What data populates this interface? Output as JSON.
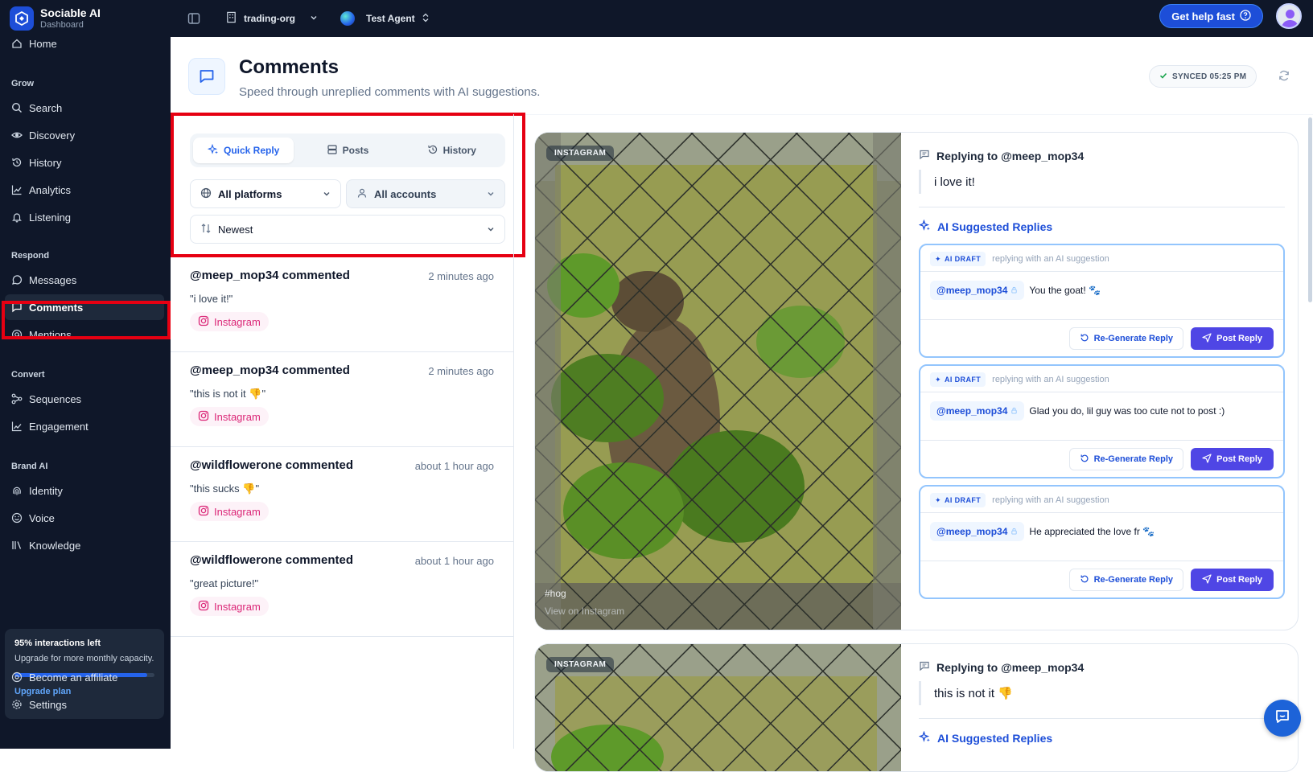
{
  "brand": {
    "name": "Sociable AI",
    "subtitle": "Dashboard"
  },
  "topbar": {
    "org": "trading-org",
    "agent": "Test Agent",
    "help_label": "Get help fast"
  },
  "sidebar": {
    "cut_item": "Home",
    "sections": {
      "grow": "Grow",
      "respond": "Respond",
      "convert": "Convert",
      "brand": "Brand AI"
    },
    "grow_items": [
      "Search",
      "Discovery",
      "History",
      "Analytics",
      "Listening"
    ],
    "respond_items": [
      "Messages",
      "Comments",
      "Mentions"
    ],
    "convert_items": [
      "Sequences",
      "Engagement"
    ],
    "brand_items": [
      "Identity",
      "Voice",
      "Knowledge"
    ],
    "active_item": "Comments",
    "upgrade": {
      "title": "95% interactions left",
      "text": "Upgrade for more monthly capacity.",
      "percent_left": 95,
      "link": "Upgrade plan"
    },
    "footer_items": [
      "Become an affiliate",
      "Settings"
    ]
  },
  "header": {
    "title": "Comments",
    "subtitle": "Speed through unreplied comments with AI suggestions.",
    "synced": "SYNCED 05:25 PM"
  },
  "filters": {
    "tabs": [
      "Quick Reply",
      "Posts",
      "History"
    ],
    "active_tab": "Quick Reply",
    "platform": "All platforms",
    "accounts": "All accounts",
    "sort": "Newest"
  },
  "comments": [
    {
      "user": "@meep_mop34 commented",
      "time": "2 minutes ago",
      "text": "\"i love it!\"",
      "platform": "Instagram"
    },
    {
      "user": "@meep_mop34 commented",
      "time": "2 minutes ago",
      "text": "\"this is not it 👎\"",
      "platform": "Instagram"
    },
    {
      "user": "@wildflowerone commented",
      "time": "about 1 hour ago",
      "text": "\"this sucks 👎\"",
      "platform": "Instagram"
    },
    {
      "user": "@wildflowerone commented",
      "time": "about 1 hour ago",
      "text": "\"great picture!\"",
      "platform": "Instagram"
    }
  ],
  "detail": {
    "media_badge": "INSTAGRAM",
    "media_caption": "#hog",
    "media_link": "View on Instagram",
    "replying_to": "Replying to @meep_mop34",
    "quote": "i love it!",
    "suggested_title": "AI Suggested Replies",
    "draft_tag": "AI DRAFT",
    "draft_hint": "replying with an AI suggestion",
    "mention": "@meep_mop34",
    "drafts": [
      {
        "text": "You the goat! 🐾"
      },
      {
        "text": "Glad you do, lil guy was too cute not to post :)"
      },
      {
        "text": "He appreciated the love fr 🐾"
      }
    ],
    "regen_label": "Re-Generate Reply",
    "post_label": "Post Reply"
  },
  "detail2": {
    "media_badge": "INSTAGRAM",
    "replying_to": "Replying to @meep_mop34",
    "quote": "this is not it 👎",
    "suggested_title": "AI Suggested Replies"
  },
  "colors": {
    "sidebar_bg": "#0f1729",
    "accent": "#1d4ed8",
    "post_button": "#4f46e5",
    "annotation_red": "#e60012"
  }
}
